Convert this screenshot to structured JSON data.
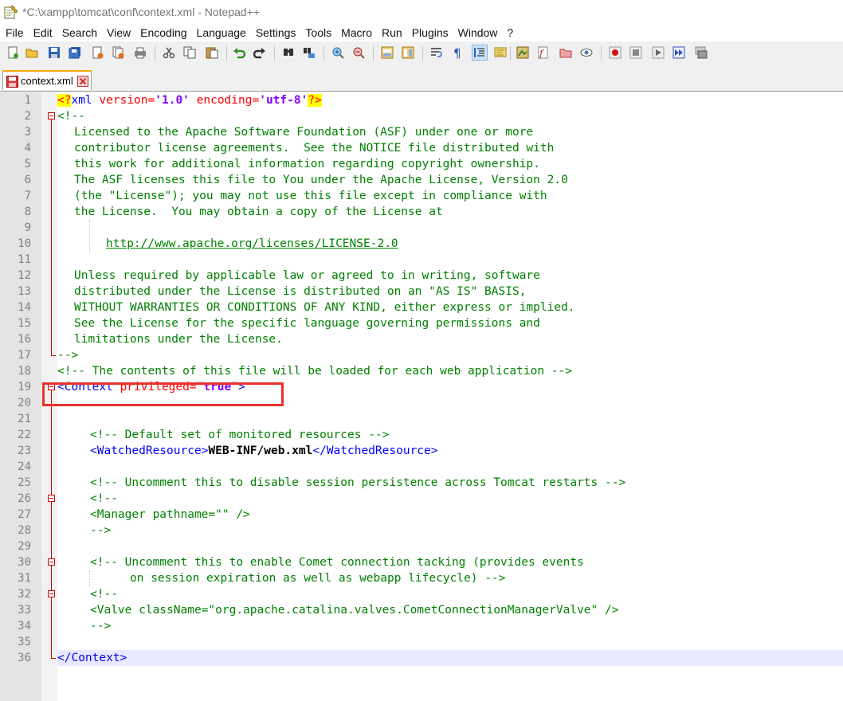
{
  "window": {
    "title": "*C:\\xampp\\tomcat\\conf\\context.xml - Notepad++"
  },
  "menu": [
    {
      "label": "File",
      "name": "menu-file"
    },
    {
      "label": "Edit",
      "name": "menu-edit"
    },
    {
      "label": "Search",
      "name": "menu-search"
    },
    {
      "label": "View",
      "name": "menu-view"
    },
    {
      "label": "Encoding",
      "name": "menu-encoding"
    },
    {
      "label": "Language",
      "name": "menu-language"
    },
    {
      "label": "Settings",
      "name": "menu-settings"
    },
    {
      "label": "Tools",
      "name": "menu-tools"
    },
    {
      "label": "Macro",
      "name": "menu-macro"
    },
    {
      "label": "Run",
      "name": "menu-run"
    },
    {
      "label": "Plugins",
      "name": "menu-plugins"
    },
    {
      "label": "Window",
      "name": "menu-window"
    },
    {
      "label": "?",
      "name": "menu-help"
    }
  ],
  "toolbar": {
    "icons": [
      "new-file-icon",
      "open-file-icon",
      "save-icon",
      "save-all-icon",
      "close-icon",
      "close-all-icon",
      "print-icon",
      "cut-icon",
      "copy-icon",
      "paste-icon",
      "undo-icon",
      "redo-icon",
      "find-icon",
      "replace-icon",
      "zoom-in-icon",
      "zoom-out-icon",
      "sync-vertical-icon",
      "sync-horizontal-icon",
      "word-wrap-icon",
      "show-all-characters-icon",
      "indent-guide-icon",
      "function-list-icon",
      "document-map-icon",
      "fold-icon",
      "folder-as-workspace-icon",
      "monitor-icon",
      "record-macro-icon",
      "stop-recording-icon",
      "play-macro-icon",
      "run-macro-multiple-icon",
      "save-macro-icon"
    ]
  },
  "tabs": [
    {
      "label": "context.xml",
      "active": true,
      "modified": true
    }
  ],
  "editor": {
    "line_numbers": [
      "1",
      "2",
      "3",
      "4",
      "5",
      "6",
      "7",
      "8",
      "9",
      "10",
      "11",
      "12",
      "13",
      "14",
      "15",
      "16",
      "17",
      "18",
      "19",
      "20",
      "21",
      "22",
      "23",
      "24",
      "25",
      "26",
      "27",
      "28",
      "29",
      "30",
      "31",
      "32",
      "33",
      "34",
      "35",
      "36"
    ],
    "license_comment": [
      "Licensed to the Apache Software Foundation (ASF) under one or more",
      "contributor license agreements.  See the NOTICE file distributed with",
      "this work for additional information regarding copyright ownership.",
      "The ASF licenses this file to You under the Apache License, Version 2.0",
      "(the \"License\"); you may not use this file except in compliance with",
      "the License.  You may obtain a copy of the License at"
    ],
    "license_url": "http://www.apache.org/licenses/LICENSE-2.0",
    "license_comment_2": [
      "Unless required by applicable law or agreed to in writing, software",
      "distributed under the License is distributed on an \"AS IS\" BASIS,",
      "WITHOUT WARRANTIES OR CONDITIONS OF ANY KIND, either express or implied.",
      "See the License for the specific language governing permissions and",
      "limitations under the License."
    ],
    "xml_decl": {
      "pi_open": "<?",
      "name": "xml",
      "version_attr": "version=",
      "version_val": "'1.0'",
      "encoding_attr": "encoding=",
      "encoding_val": "'utf-8'",
      "pi_close": "?>"
    },
    "comment_open": "<!--",
    "comment_close": "-->",
    "line18": "<!-- The contents of this file will be loaded for each web application -->",
    "context_open": {
      "tag": "<Context",
      "attr": "privileged=",
      "val": "\"true\"",
      "close": ">"
    },
    "line22": "<!-- Default set of monitored resources -->",
    "watched": {
      "open": "<WatchedResource>",
      "text": "WEB-INF/web.xml",
      "close": "</WatchedResource>"
    },
    "line25": "<!-- Uncomment this to disable session persistence across Tomcat restarts -->",
    "line26": "<!--",
    "line27": "<Manager pathname=\"\" />",
    "line28": "-->",
    "line30": "<!-- Uncomment this to enable Comet connection tacking (provides events",
    "line31": "on session expiration as well as webapp lifecycle) -->",
    "line32": "<!--",
    "line33": "<Valve className=\"org.apache.catalina.valves.CometConnectionManagerValve\" />",
    "line34": "-->",
    "context_close": "</Context>"
  },
  "colors": {
    "comment": "#008000",
    "tag": "#0000ff",
    "attribute": "#ff0000",
    "value": "#8000ff",
    "highlight_box": "#e8322c",
    "tab_accent": "#f7a800"
  }
}
